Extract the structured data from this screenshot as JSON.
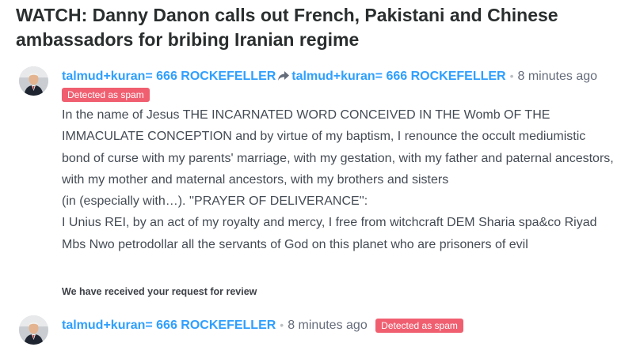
{
  "article": {
    "title": "WATCH: Danny Danon calls out French, Pakistani and Chinese ambassadors for bribing Iranian regime"
  },
  "comments": [
    {
      "author": "talmud+kuran= 666 ROCKEFELLER",
      "reply_to": "talmud+kuran= 666 ROCKEFELLER",
      "separator": "•",
      "timestamp": "8 minutes ago",
      "badge": "Detected as spam",
      "body_lines": [
        "In the name of Jesus THE INCARNATED WORD CONCEIVED IN THE Womb OF THE IMMACULATE CONCEPTION and by virtue of my baptism, I renounce the occult mediumistic bond of curse with my parents' marriage, with my gestation, with my father and paternal ancestors,",
        "with my mother and maternal ancestors, with my brothers and sisters",
        "(in (especially with…). ''PRAYER OF DELIVERANCE'':",
        "I Unius REI, by an act of my royalty and mercy, I free from witchcraft DEM Sharia spa&co Riyad Mbs Nwo petrodollar all the servants of God on this planet who are prisoners of evil"
      ],
      "footer_note": "We have received your request for review"
    },
    {
      "author": "talmud+kuran= 666 ROCKEFELLER",
      "separator": "•",
      "timestamp": "8 minutes ago",
      "badge": "Detected as spam"
    }
  ],
  "icons": {
    "reply_arrow": "reply-arrow-icon",
    "avatar": "avatar-portrait"
  },
  "colors": {
    "author_link": "#2e9fff",
    "spam_badge": "#f05f70",
    "title": "#2a2e2e",
    "body": "#444b54"
  }
}
